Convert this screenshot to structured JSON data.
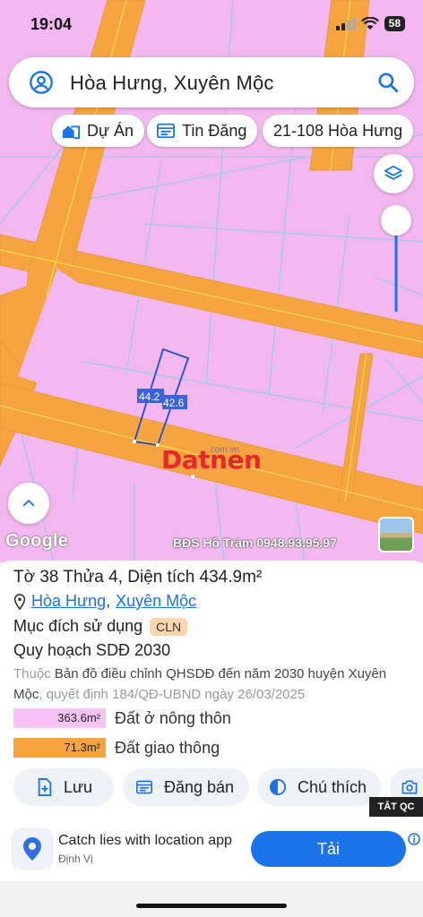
{
  "status": {
    "time": "19:04",
    "battery": "58"
  },
  "search": {
    "query": "Hòa Hưng, Xuyên Mộc"
  },
  "chips": [
    {
      "label": "Dự Án",
      "icon": "house-icon"
    },
    {
      "label": "Tin Đăng",
      "icon": "listing-icon"
    },
    {
      "label": "21-108 Hòa Hưng"
    }
  ],
  "map": {
    "dim_top": "44.2",
    "dim_right": "42.6",
    "google": "Google",
    "credit": "BĐS Hồ Tràm 0948.93.95.97",
    "watermark": "Datnen",
    "watermark_sub": ".com.vn",
    "colors": {
      "land": "#f3b8f0",
      "road": "#f5a43f",
      "parcel_line": "#7ec8e3",
      "highlight": "#1e4bd6"
    }
  },
  "parcel": {
    "title_prefix": "Tờ 38 Thửa 4, Diện tích ",
    "area": "434.9",
    "area_unit": "m²",
    "ward": "Hòa Hưng",
    "district": "Xuyên Mộc",
    "sep": ",",
    "purpose_label": "Mục đích sử dụng",
    "purpose_code": "CLN",
    "plan_title": "Quy hoạch SDĐ 2030",
    "desc_prefix": "Thuộc",
    "desc_map": "Bản đồ điều chỉnh QHSDĐ đến năm 2030 huyện Xuyên Mộc",
    "desc_decision": ", quyết định 184/QĐ-UBND ngày 26/03/2025",
    "legend": [
      {
        "value": "363.6m²",
        "label": "Đất ở nông thôn",
        "color": "#f7c3f4"
      },
      {
        "value": "71.3m²",
        "label": "Đất giao thông",
        "color": "#f5a43f"
      }
    ]
  },
  "actions": [
    {
      "label": "Lưu",
      "icon": "add-doc-icon"
    },
    {
      "label": "Đăng bán",
      "icon": "post-icon"
    },
    {
      "label": "Chú thích",
      "icon": "legend-icon"
    }
  ],
  "ad": {
    "tag": "TẮT QC",
    "headline": "Catch lies with location app",
    "advertiser": "Định Vị",
    "cta": "Tải"
  }
}
